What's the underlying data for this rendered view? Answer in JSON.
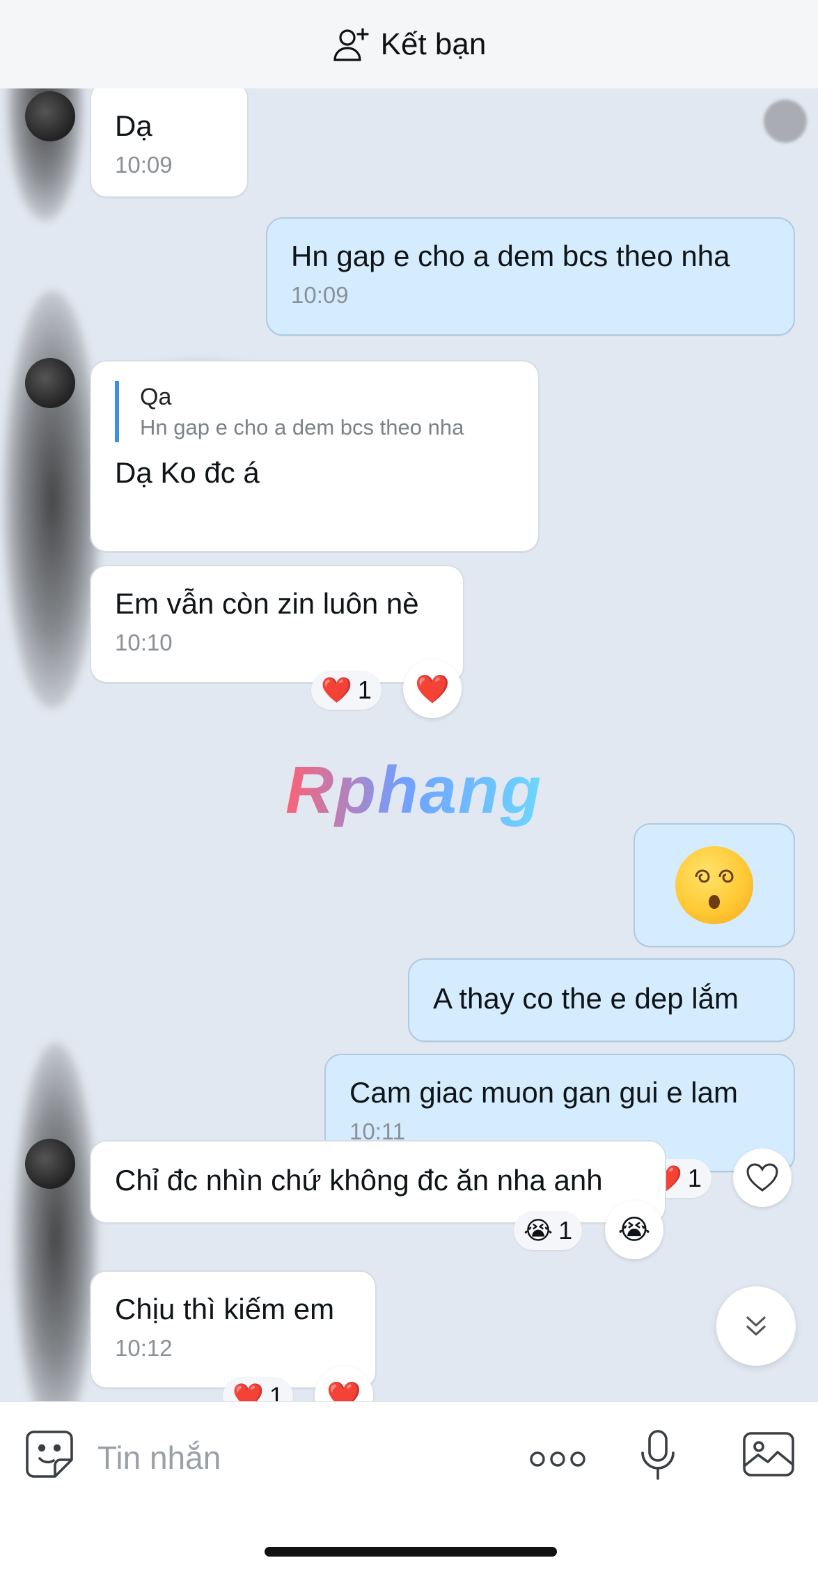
{
  "header": {
    "add_friend_label": "Kết bạn",
    "add_friend_icon": "person-add-icon"
  },
  "messages": [
    {
      "side": "in",
      "text": "Dạ",
      "time": "10:09"
    },
    {
      "side": "out",
      "text": "Hn gap e cho a dem bcs theo nha",
      "time": "10:09"
    },
    {
      "side": "in",
      "reply_name": "Qa",
      "reply_text": "Hn gap e cho a dem bcs theo nha",
      "text": "Dạ Ko đc á"
    },
    {
      "side": "in",
      "text": "Em vẫn còn zin luôn nè",
      "time": "10:10",
      "reaction": {
        "emoji": "❤️",
        "count": "1"
      }
    },
    {
      "side": "out",
      "sticker": "dizzy-face-emoji"
    },
    {
      "side": "out",
      "text": "A thay co the e dep lắm"
    },
    {
      "side": "out",
      "text": "Cam giac muon gan gui e lam",
      "time": "10:11",
      "reaction": {
        "emoji": "❤️",
        "count": "1"
      }
    },
    {
      "side": "in",
      "text": "Chỉ đc nhìn chứ không đc ăn nha anh",
      "reaction": {
        "emoji": "😭",
        "count": "1"
      }
    },
    {
      "side": "in",
      "text": "Chịu thì kiếm em",
      "time": "10:12",
      "reaction": {
        "emoji": "❤️",
        "count": "1"
      }
    }
  ],
  "watermark": "Rphang",
  "reaction_button_heart": "❤️",
  "reaction_button_cry": "😭",
  "input": {
    "placeholder": "Tin nhắn"
  },
  "colors": {
    "background": "#e2e8f1",
    "incoming_bubble": "#ffffff",
    "outgoing_bubble": "#d4ecfd",
    "accent": "#3b8fe4"
  }
}
